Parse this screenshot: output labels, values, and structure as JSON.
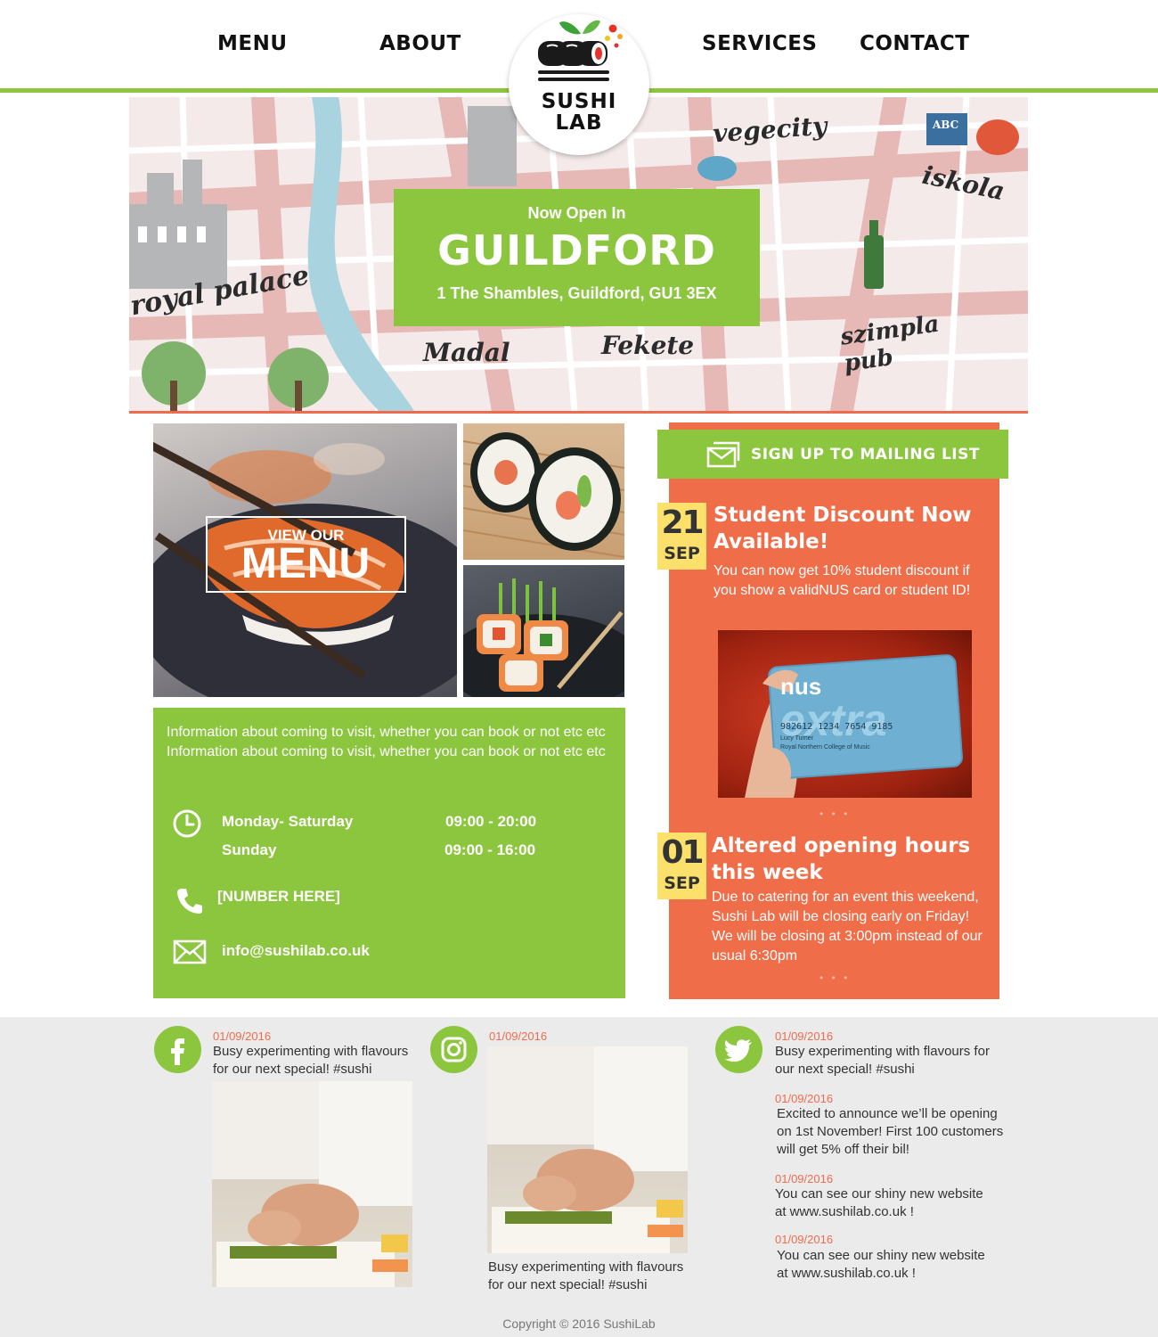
{
  "nav": {
    "menu": "MENU",
    "about": "ABOUT",
    "services": "SERVICES",
    "contact": "CONTACT"
  },
  "logo": {
    "line1": "SUSHI",
    "line2": "LAB"
  },
  "hero": {
    "map_words": [
      "royal palace",
      "vegecity",
      "iskola",
      "szimpla pub",
      "Madal",
      "Fekete",
      "ABC"
    ],
    "banner": {
      "small": "Now Open In",
      "city": "GUILDFORD",
      "address": "1 The Shambles, Guildford, GU1 3EX"
    }
  },
  "menu_tile": {
    "small": "VIEW OUR",
    "big": "MENU"
  },
  "info": {
    "description": "Information about coming to visit, whether you can book or not etc etc Information about coming to visit, whether you can book or not etc etc",
    "hours": [
      {
        "days": "Monday- Saturday",
        "time": "09:00 - 20:00"
      },
      {
        "days": "Sunday",
        "time": "09:00 - 16:00"
      }
    ],
    "phone": "[NUMBER HERE]",
    "email": "info@sushilab.co.uk"
  },
  "news": {
    "signup_label": "SIGN UP TO MAILING LIST",
    "items": [
      {
        "day": "21",
        "month": "SEP",
        "title": "Student Discount Now Available!",
        "body": "You can now get 10% student discount if you show a validNUS card or student ID!"
      },
      {
        "day": "01",
        "month": "SEP",
        "title": "Altered opening hours this week",
        "body": "Due to catering for an event this weekend, Sushi Lab will be closing early on Friday! We will be closing at 3:00pm instead of our usual 6:30pm"
      }
    ],
    "card": {
      "brand": "nus",
      "word": "extra",
      "number": "982612 1234 7654 9185",
      "name": "Lucy Turner",
      "college": "Royal Northern College of Music"
    },
    "dots": "• • •"
  },
  "social": {
    "facebook": {
      "date": "01/09/2016",
      "text": "Busy experimenting with flavours for our next special! #sushi"
    },
    "instagram": {
      "date": "01/09/2016",
      "caption": "Busy experimenting with flavours for our next special! #sushi"
    },
    "twitter": [
      {
        "date": "01/09/2016",
        "text": "Busy experimenting with flavours for our next special! #sushi"
      },
      {
        "date": "01/09/2016",
        "text": "Excited to announce we’ll be opening on 1st November! First 100 customers will get 5% off their bil!"
      },
      {
        "date": "01/09/2016",
        "text": "You can see our shiny new website at www.sushilab.co.uk !"
      },
      {
        "date": "01/09/2016",
        "text": "You can see our shiny new website at www.sushilab.co.uk !"
      }
    ]
  },
  "footer": {
    "copyright": "Copyright © 2016 SushiLab"
  },
  "colors": {
    "green": "#8cc63f",
    "orange": "#ef6d48",
    "yellow": "#fbe06c",
    "footer_bg": "#ebebeb"
  }
}
